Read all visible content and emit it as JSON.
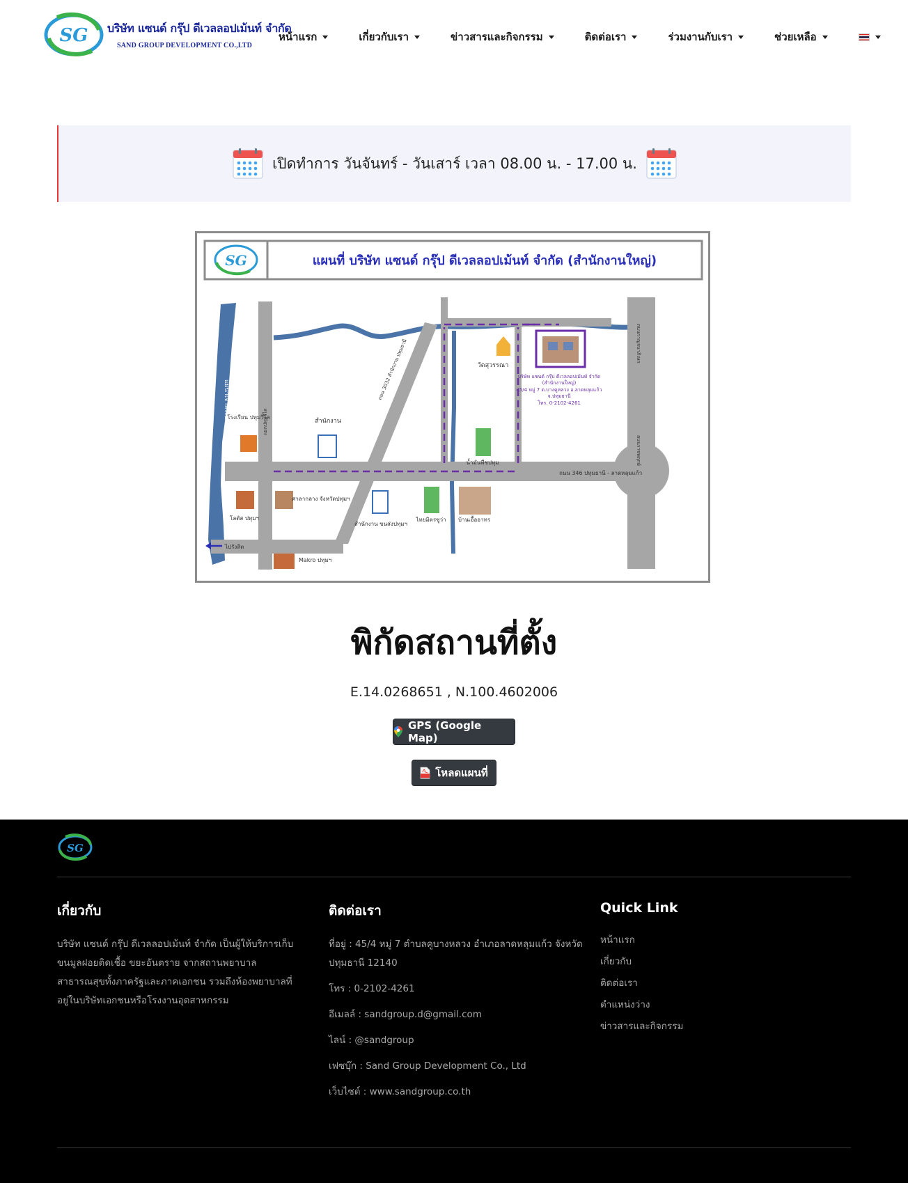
{
  "header": {
    "brand_th": "บริษัท แซนด์ กรุ๊ป ดีเวลลอปเม้นท์ จำกัด",
    "brand_en": "SAND GROUP DEVELOPMENT CO.,LTD",
    "logo_mark": "SG",
    "nav": [
      {
        "label": "หน้าแรก"
      },
      {
        "label": "เกี่ยวกับเรา"
      },
      {
        "label": "ข่าวสารและกิจกรรม"
      },
      {
        "label": "ติดต่อเรา"
      },
      {
        "label": "ร่วมงานกับเรา"
      },
      {
        "label": "ช่วยเหลือ"
      }
    ],
    "language_icon": "thai-flag-icon"
  },
  "notice": {
    "text": "เปิดทำการ วันจันทร์ - วันเสาร์ เวลา 08.00 น. - 17.00 น.",
    "icon": "calendar-icon"
  },
  "map": {
    "title": "แผนที่ บริษัท แซนด์ กรุ๊ป ดีเวลลอปเม้นท์ จำกัด (สำนักงานใหญ่)",
    "logo_mark": "SG",
    "river_label": "แม่น้ำเจ้าพระยา",
    "labels": {
      "school": "โรงเรียน ปทุมวิไล",
      "office": "สำนักงาน",
      "temple": "วัดสุวรรณา",
      "company": "บริษัท แซนด์ กรุ๊ป ดีเวลลอปเม้นท์ จำกัด",
      "company_sub": "(สำนักงานใหญ่)",
      "company_addr": "45/4 หมู่ 7 ต.บางคูหลวง อ.ลาดหลุมแก้ว",
      "company_prov": "จ.ปทุมธานี",
      "company_tel": "โทร. 0-2102-4261",
      "road_346": "ถนน 346 ปทุมธานี - ลาดหลุมแก้ว",
      "road_3032": "ถนน 3032 สำนักงาน ปทุมธานี",
      "road_right_top": "ถนนกาญจนาภิเษก",
      "road_right_bottom": "ถนนราชพฤกษ์",
      "road_left": "แยกปทุมวิไล",
      "factory": "น้ำมันพืชปทุม",
      "lotus": "โลตัส ปทุมฯ",
      "market": "ศาลากลาง จังหวัดปทุมฯ",
      "transport": "สำนักงาน ขนส่งปทุมฯ",
      "thai_m": "ไทยมิตรซูว่า",
      "apartment": "บ้านเอื้ออาทร",
      "to_rangsit": "ไปรังสิต",
      "makro": "Makro ปทุมฯ"
    }
  },
  "location": {
    "title": "พิกัดสถานที่ตั้ง",
    "coords": "E.14.0268651 , N.100.4602006",
    "gps_button": "GPS (Google Map)",
    "pdf_button": "โหลดแผนที่",
    "gps_icon": "map-pin-icon",
    "pdf_icon": "pdf-file-icon"
  },
  "footer": {
    "logo_mark": "SG",
    "about_title": "เกี่ยวกับ",
    "about_text": "บริษัท แซนด์ กรุ๊ป ดีเวลลอปเม้นท์ จำกัด เป็นผู้ให้บริการเก็บขนมูลฝอยติดเชื้อ ขยะอันตราย จากสถานพยาบาลสาธารณสุขทั้งภาครัฐและภาคเอกชน รวมถึงห้องพยาบาลที่อยู่ในบริษัทเอกชนหรือโรงงานอุตสาหกรรม",
    "contact_title": "ติดต่อเรา",
    "contact": [
      "ที่อยู่ : 45/4 หมู่ 7 ตำบลคูบางหลวง อำเภอลาดหลุมแก้ว จังหวัดปทุมธานี 12140",
      "โทร : 0-2102-4261",
      "อีเมลล์ : sandgroup.d@gmail.com",
      "ไลน์ : @sandgroup",
      "เฟซบุ๊ก : Sand Group Development Co., Ltd",
      "เว็บไซต์ : www.sandgroup.co.th"
    ],
    "quick_title": "Quick Link",
    "quick_links": [
      "หน้าแรก",
      "เกี่ยวกับ",
      "ติดต่อเรา",
      "ตำแหน่งว่าง",
      "ข่าวสารและกิจกรรม"
    ]
  }
}
